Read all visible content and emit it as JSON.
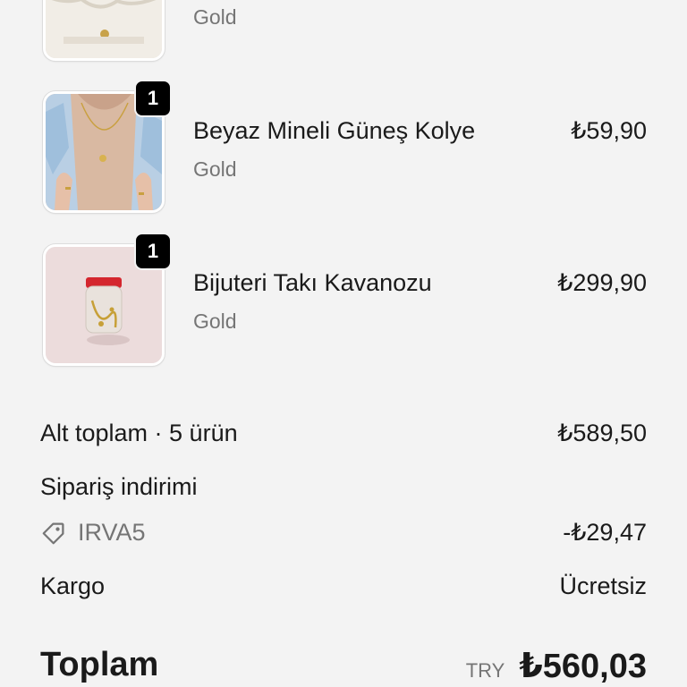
{
  "items": [
    {
      "name": "",
      "variant": "Gold",
      "price": "",
      "quantity": ""
    },
    {
      "name": "Beyaz Mineli Güneş Kolye",
      "variant": "Gold",
      "price": "₺59,90",
      "quantity": "1"
    },
    {
      "name": "Bijuteri Takı Kavanozu",
      "variant": "Gold",
      "price": "₺299,90",
      "quantity": "1"
    }
  ],
  "summary": {
    "subtotal_label": "Alt toplam · 5 ürün",
    "subtotal_value": "₺589,50",
    "order_discount_label": "Sipariş indirimi",
    "discount_code": "IRVA5",
    "discount_value": "-₺29,47",
    "shipping_label": "Kargo",
    "shipping_value": "Ücretsiz",
    "total_label": "Toplam",
    "currency_code": "TRY",
    "total_value": "₺560,03"
  },
  "icons": {
    "tag": "tag-icon"
  }
}
